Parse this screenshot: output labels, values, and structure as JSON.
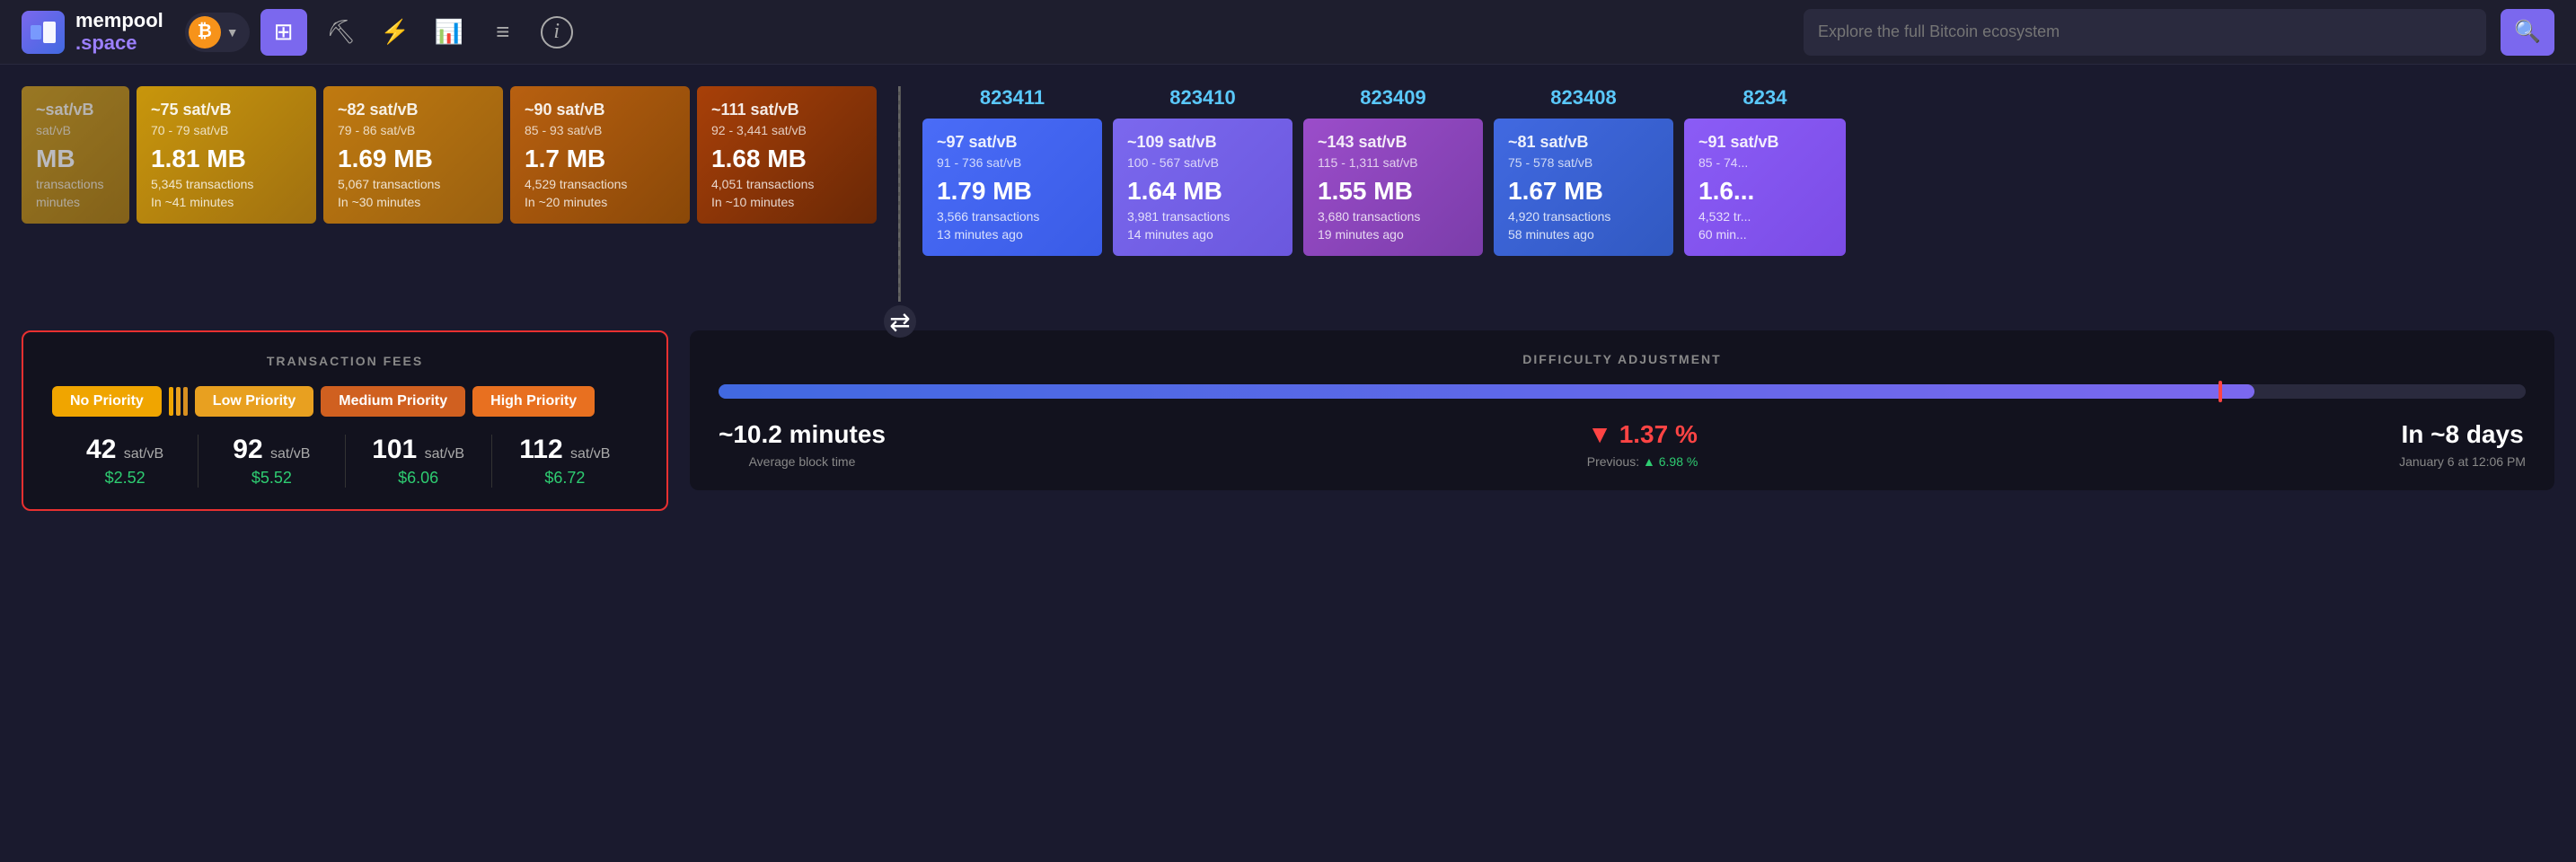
{
  "navbar": {
    "logo_mempool": "mempool",
    "logo_space": ".space",
    "btc_symbol": "₿",
    "search_placeholder": "Explore the full Bitcoin ecosystem",
    "search_icon": "🔍",
    "nav_items": [
      {
        "name": "dashboard",
        "icon": "⊡",
        "active": true
      },
      {
        "name": "mining",
        "icon": "⛏"
      },
      {
        "name": "lightning",
        "icon": "⚡"
      },
      {
        "name": "charts",
        "icon": "📊"
      },
      {
        "name": "docs",
        "icon": "📄"
      },
      {
        "name": "info",
        "icon": "ℹ"
      }
    ]
  },
  "mempool_blocks": [
    {
      "top_label": "~75 sat/vB",
      "range": "70 - 79 sat/vB",
      "size": "1.81 MB",
      "transactions": "5,345 transactions",
      "time": "In ~41 minutes",
      "color": "mb-1"
    },
    {
      "top_label": "~82 sat/vB",
      "range": "79 - 86 sat/vB",
      "size": "1.69 MB",
      "transactions": "5,067 transactions",
      "time": "In ~30 minutes",
      "color": "mb-2"
    },
    {
      "top_label": "~90 sat/vB",
      "range": "85 - 93 sat/vB",
      "size": "1.7 MB",
      "transactions": "4,529 transactions",
      "time": "In ~20 minutes",
      "color": "mb-3"
    },
    {
      "top_label": "~111 sat/vB",
      "range": "92 - 3,441 sat/vB",
      "size": "1.68 MB",
      "transactions": "4,051 transactions",
      "time": "In ~10 minutes",
      "color": "mb-5"
    }
  ],
  "mined_blocks": [
    {
      "number": "823411",
      "top_label": "~97 sat/vB",
      "range": "91 - 736 sat/vB",
      "size": "1.79 MB",
      "transactions": "3,566 transactions",
      "time": "13 minutes ago",
      "color": "mined-blue"
    },
    {
      "number": "823410",
      "top_label": "~109 sat/vB",
      "range": "100 - 567 sat/vB",
      "size": "1.64 MB",
      "transactions": "3,981 transactions",
      "time": "14 minutes ago",
      "color": "mined-purple"
    },
    {
      "number": "823409",
      "top_label": "~143 sat/vB",
      "range": "115 - 1,311 sat/vB",
      "size": "1.55 MB",
      "transactions": "3,680 transactions",
      "time": "19 minutes ago",
      "color": "mined-purple2"
    },
    {
      "number": "823408",
      "top_label": "~81 sat/vB",
      "range": "75 - 578 sat/vB",
      "size": "1.67 MB",
      "transactions": "4,920 transactions",
      "time": "58 minutes ago",
      "color": "mined-blue2"
    },
    {
      "number": "8234",
      "top_label": "~91 sat/vB",
      "range": "85 - 74...",
      "size": "1.6...",
      "transactions": "4,532 tr...",
      "time": "60 min...",
      "color": "mined-purple3",
      "partial": true
    }
  ],
  "transaction_fees": {
    "title": "TRANSACTION FEES",
    "priorities": [
      {
        "label": "No Priority",
        "style": "priority-no"
      },
      {
        "label": "Low Priority",
        "style": "priority-low"
      },
      {
        "label": "Medium Priority",
        "style": "priority-med"
      },
      {
        "label": "High Priority",
        "style": "priority-high"
      }
    ],
    "fees": [
      {
        "sat": "42",
        "unit": "sat/vB",
        "usd": "$2.52"
      },
      {
        "sat": "92",
        "unit": "sat/vB",
        "usd": "$5.52"
      },
      {
        "sat": "101",
        "unit": "sat/vB",
        "usd": "$6.06"
      },
      {
        "sat": "112",
        "unit": "sat/vB",
        "usd": "$6.72"
      }
    ]
  },
  "difficulty": {
    "title": "DIFFICULTY ADJUSTMENT",
    "progress_pct": 85,
    "stats": [
      {
        "value": "~10.2 minutes",
        "label": "Average block time",
        "sub": ""
      },
      {
        "value": "▼ 1.37 %",
        "label": "Previous:",
        "sub": "▲ 6.98 %",
        "value_color": "pct-down"
      },
      {
        "value": "In ~8 days",
        "label": "January 6 at 12:06 PM",
        "sub": ""
      }
    ]
  },
  "partial_block": {
    "top_label": "~sat/vB",
    "range": "sat/vB",
    "size": "MB",
    "transactions": "transactions",
    "time": "minutes"
  }
}
